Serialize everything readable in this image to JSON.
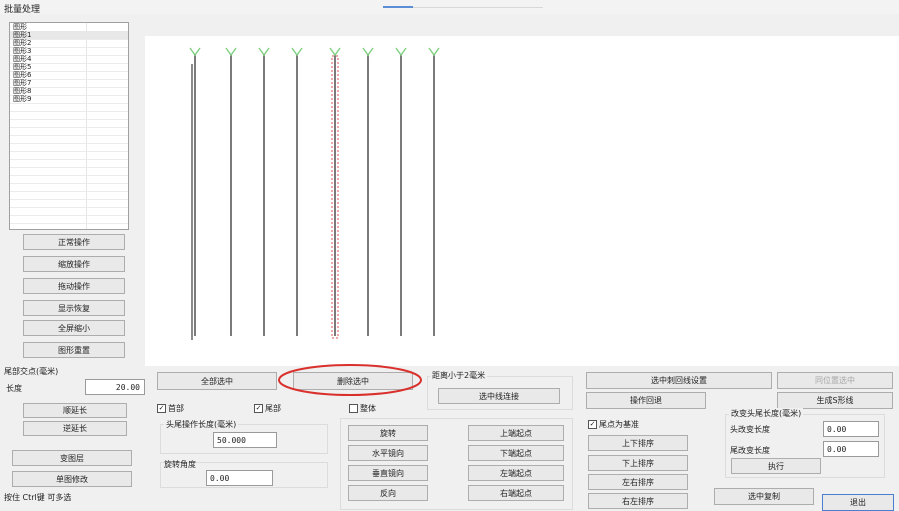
{
  "window": {
    "title": "批量处理"
  },
  "list": {
    "items": [
      "图形",
      "图形1",
      "图形2",
      "图形3",
      "图形4",
      "图形5",
      "图形6",
      "图形7",
      "图形8",
      "图形9"
    ],
    "selected_index": 1
  },
  "left_buttons": {
    "normal": "正常操作",
    "zoom": "缩放操作",
    "pan": "拖动操作",
    "restore": "显示恢复",
    "shrink": "全屏缩小",
    "redraw": "图形重置"
  },
  "tail_point": {
    "header": "尾部交点(毫米)",
    "length_label": "长度",
    "length_value": "20.00",
    "extend_label": "顺延长",
    "reverse_label": "逆延长"
  },
  "bottom_left": {
    "change_layer": "变图层",
    "single_edit": "单图修改",
    "status": "按住 Ctrl键 可多选"
  },
  "selection": {
    "select_all": "全部选中",
    "deselect": "删除选中",
    "distance_label": "距离小于2毫米",
    "connect": "选中线连接"
  },
  "options": {
    "head": "首部",
    "tail": "尾部",
    "whole": "整体",
    "head_checked": true,
    "tail_checked": true,
    "whole_checked": false
  },
  "head_tail": {
    "label": "头尾操作长度(毫米)",
    "value": "50.000",
    "rotate_label": "旋转角度",
    "rotate_value": "0.00"
  },
  "transform": {
    "rotate": "旋转",
    "hmirror": "水平镜向",
    "vmirror": "垂直镜向",
    "reverse": "反向",
    "top_start": "上端起点",
    "bottom_start": "下端起点",
    "left_start": "左端起点",
    "right_start": "右端起点"
  },
  "right_panel": {
    "loop_setting": "选中刺回线设置",
    "position_select": "同位置选中",
    "undo": "操作回退",
    "generate_loop": "生成S形线",
    "tail_base": "尾点为基准",
    "tail_base_checked": true,
    "sort_ud": "上下排序",
    "sort_du": "下上排序",
    "sort_lr": "左右排序",
    "sort_rl": "右左排序",
    "change_len_header": "改变头尾长度(毫米)",
    "head_change_label": "头改变长度",
    "head_change_value": "0.00",
    "tail_change_label": "尾改变长度",
    "tail_change_value": "0.00",
    "execute": "执行",
    "copy_selected": "选中复制",
    "exit": "退出"
  },
  "colors": {
    "line": "#5a5a5a",
    "green_mark": "#7fcf7f",
    "selected_dash": "#d9534f",
    "highlight_circle": "#d9302c"
  }
}
